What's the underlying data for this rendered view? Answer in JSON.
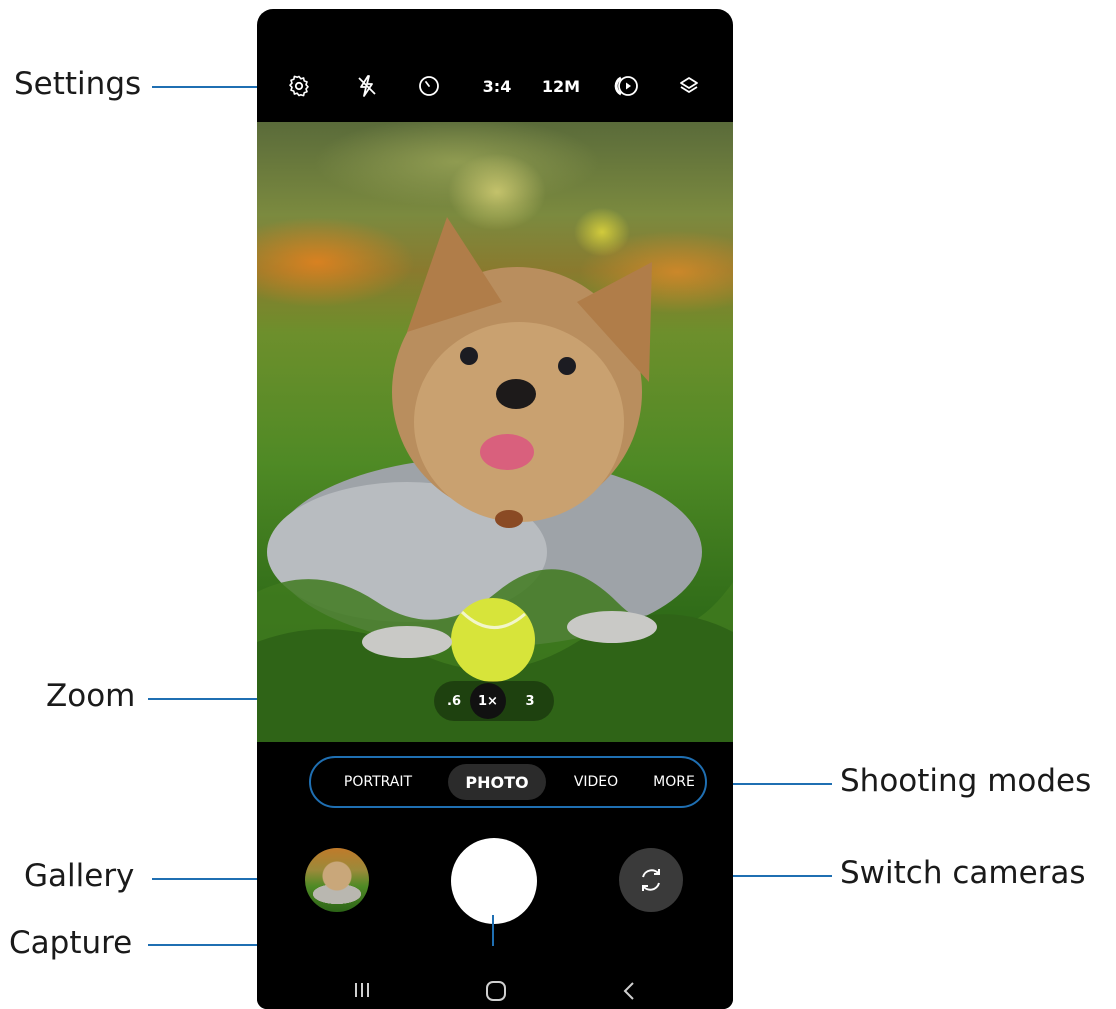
{
  "callouts": {
    "settings": "Settings",
    "zoom": "Zoom",
    "shooting_modes": "Shooting modes",
    "gallery": "Gallery",
    "switch_cameras": "Switch cameras",
    "capture": "Capture"
  },
  "toolbar": {
    "settings_icon": "gear-icon",
    "flash_icon": "flash-off-icon",
    "timer_icon": "timer-icon",
    "ratio": "3:4",
    "resolution": "12M",
    "motion_icon": "motion-photo-icon",
    "filters_icon": "layers-icon"
  },
  "zoom": {
    "levels": [
      ".6",
      "1×",
      "3"
    ],
    "selected": "1×"
  },
  "modes": {
    "items": [
      "PORTRAIT",
      "PHOTO",
      "VIDEO",
      "MORE"
    ],
    "selected": "PHOTO"
  },
  "colors": {
    "accent": "#1f6fb2",
    "phone_bg": "#000000"
  }
}
